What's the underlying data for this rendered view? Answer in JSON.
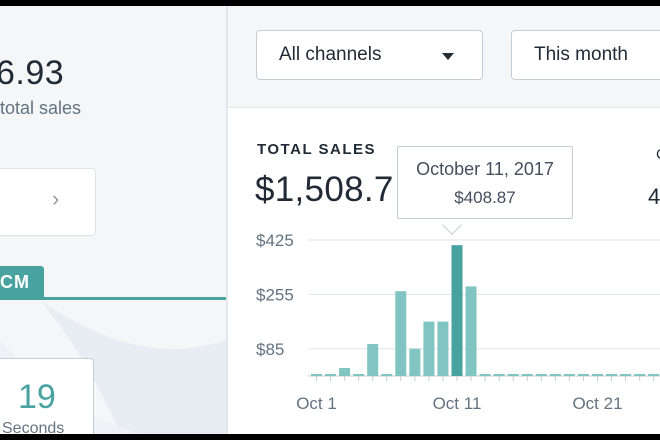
{
  "sidebar": {
    "big_value": "6.93",
    "sub_label": "total sales",
    "tab_label": "CM",
    "countdown": {
      "value": "19",
      "label": "Seconds"
    }
  },
  "filters": {
    "channels": "All channels",
    "period": "This month"
  },
  "report": {
    "title": "TOTAL SALES",
    "value": "$1,508.7",
    "side_label": "C",
    "side_value": "4"
  },
  "tooltip": {
    "date": "October 11, 2017",
    "value": "$408.87"
  },
  "chart_data": {
    "type": "bar",
    "title": "TOTAL SALES",
    "categories": [
      "Oct 1",
      "Oct 2",
      "Oct 3",
      "Oct 4",
      "Oct 5",
      "Oct 6",
      "Oct 7",
      "Oct 8",
      "Oct 9",
      "Oct 10",
      "Oct 11",
      "Oct 12",
      "Oct 13",
      "Oct 14",
      "Oct 15",
      "Oct 16",
      "Oct 17",
      "Oct 18",
      "Oct 19",
      "Oct 20",
      "Oct 21",
      "Oct 22",
      "Oct 23",
      "Oct 24",
      "Oct 25",
      "Oct 26",
      "Oct 27"
    ],
    "values": [
      0,
      0,
      25,
      0,
      100,
      0,
      265,
      85,
      170,
      170,
      408.87,
      280,
      0,
      0,
      0,
      0,
      0,
      0,
      0,
      0,
      0,
      0,
      0,
      0,
      0,
      0,
      0
    ],
    "highlight_index": 10,
    "y_ticks": [
      "$425",
      "$255",
      "$85"
    ],
    "y_tick_values": [
      425,
      255,
      85
    ],
    "x_ticks": [
      "Oct 1",
      "Oct 11",
      "Oct 21"
    ],
    "x_tick_indices": [
      0,
      10,
      20
    ],
    "ylim": [
      0,
      425
    ],
    "colors": {
      "bar": "#80c5c2",
      "highlight": "#47a2a0",
      "grid": "#dfe3e8",
      "baseline": "#c4cdd5"
    }
  }
}
